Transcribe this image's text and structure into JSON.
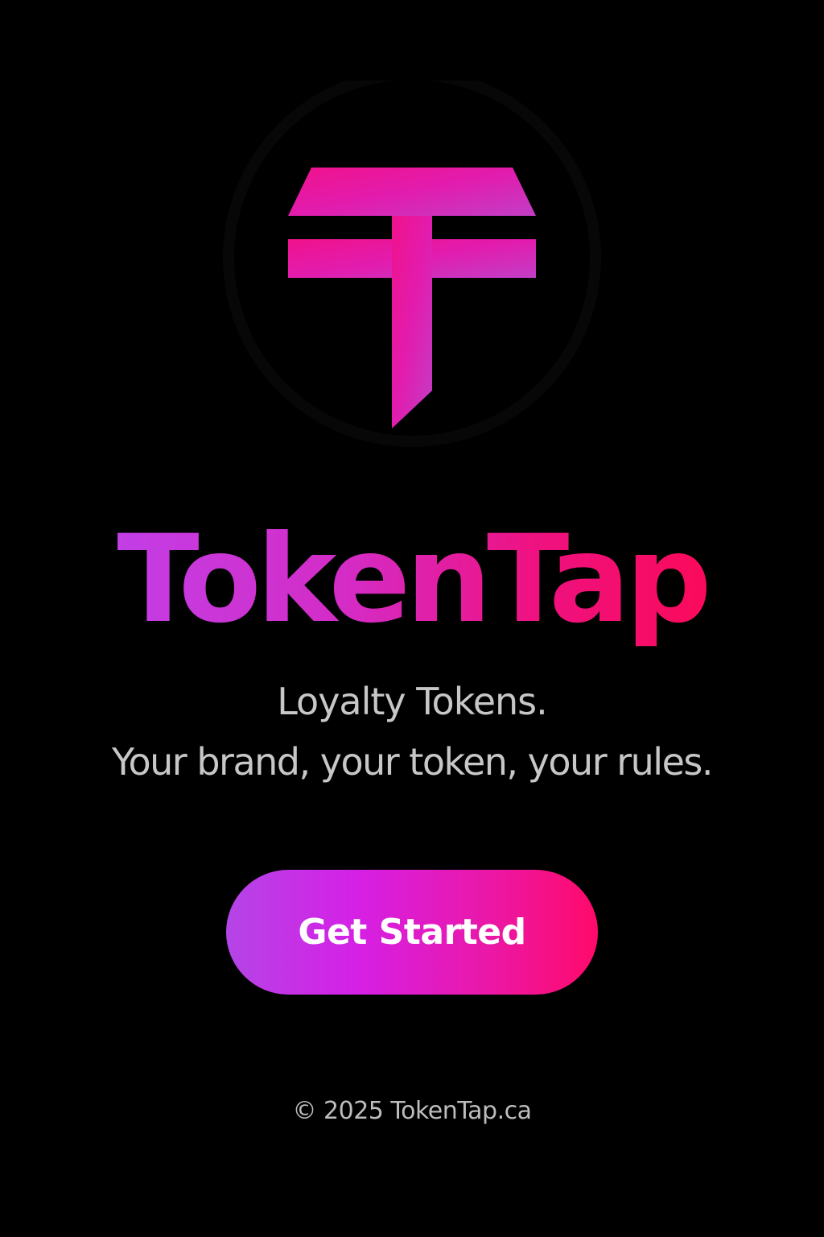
{
  "brand": {
    "logo_icon": "tokentap-t-icon",
    "name": "TokenTap",
    "colors": {
      "magenta": "#e0199a",
      "violet": "#c23ee6",
      "hot_pink": "#fa0a5a"
    }
  },
  "hero": {
    "tagline_line1": "Loyalty Tokens.",
    "tagline_line2": "Your brand, your token, your rules."
  },
  "cta": {
    "label": "Get Started"
  },
  "footer": {
    "copyright": "© 2025 TokenTap.ca"
  },
  "background_color": "#000000"
}
